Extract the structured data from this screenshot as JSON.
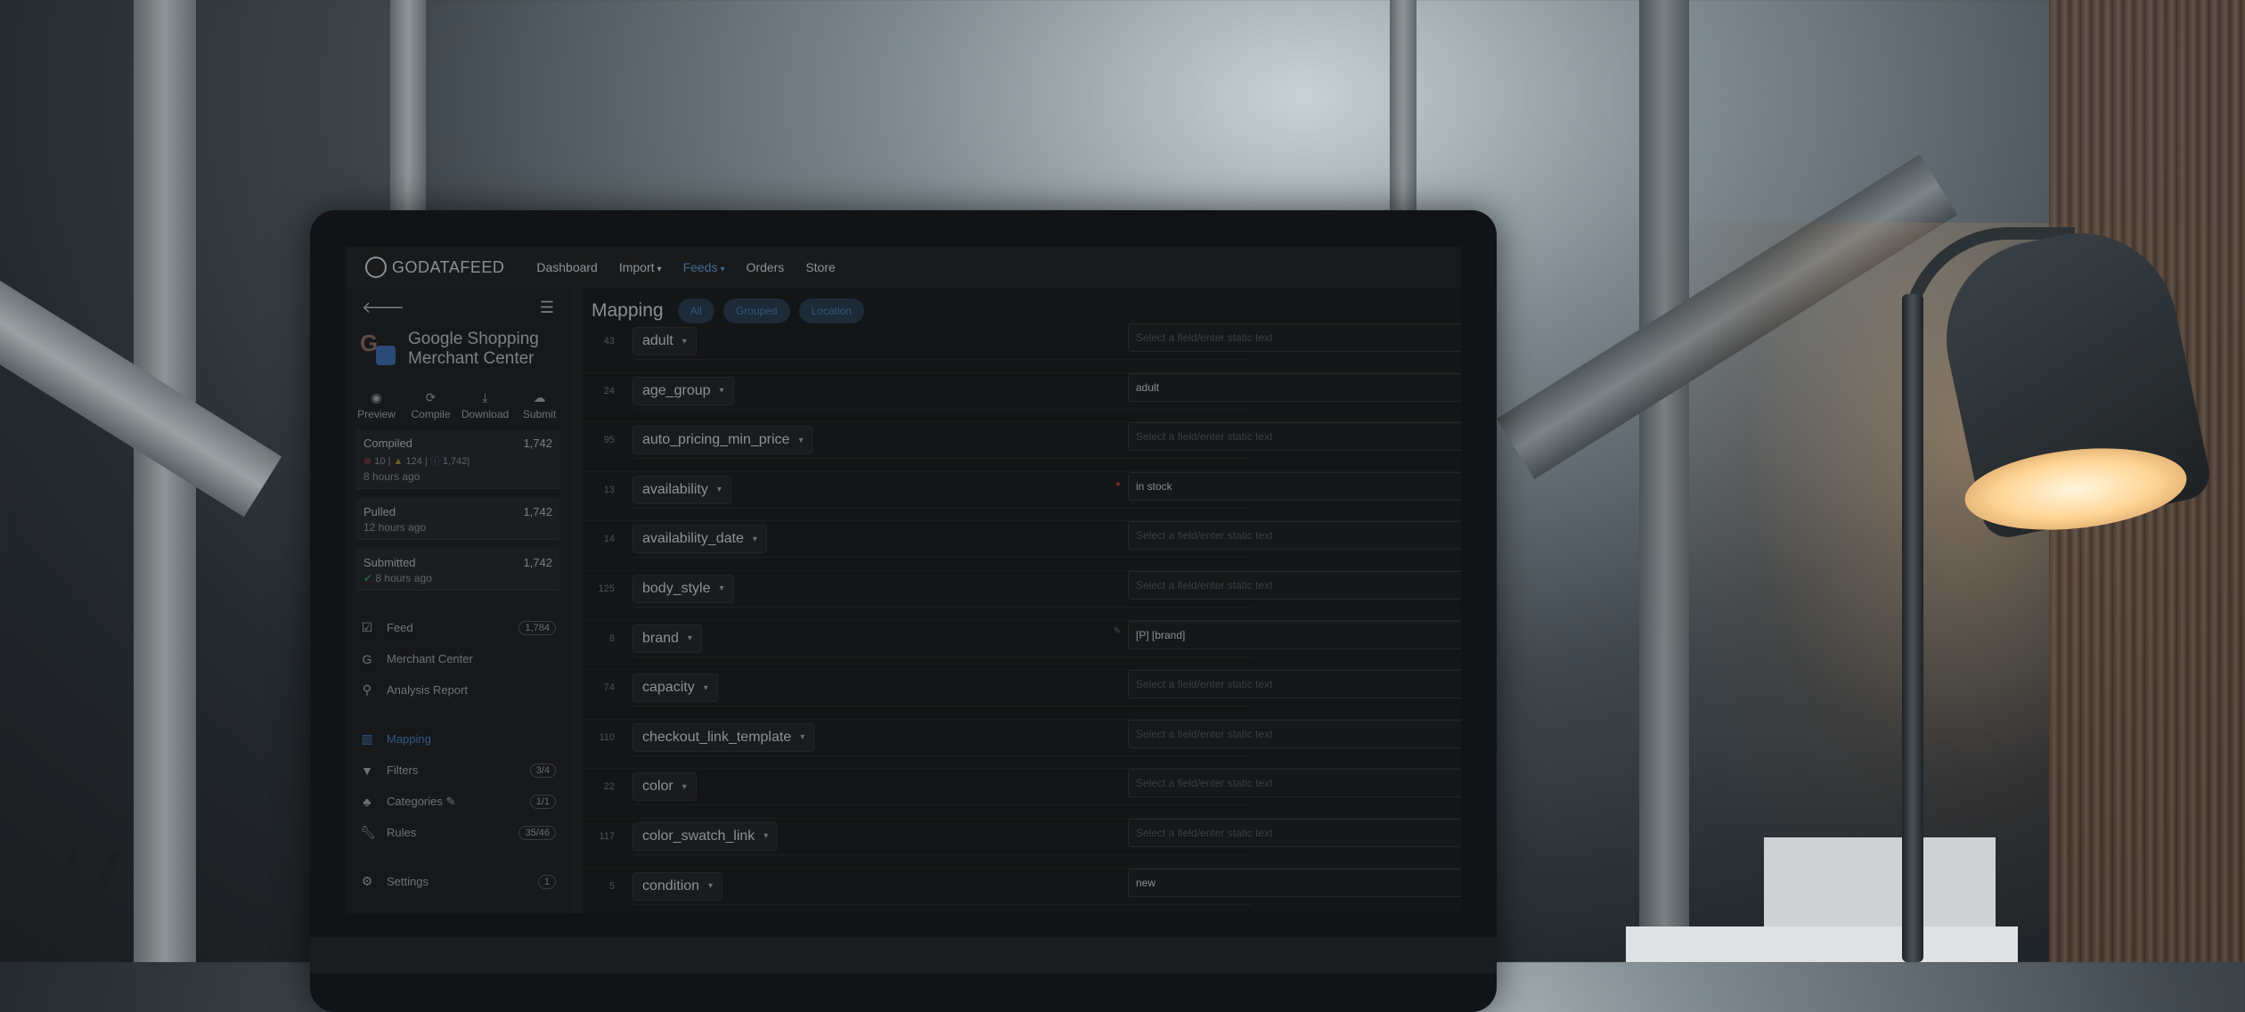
{
  "nav": {
    "logo": "GODATAFEED",
    "items": [
      {
        "label": "Dashboard",
        "caret": false,
        "active": false
      },
      {
        "label": "Import",
        "caret": true,
        "active": false
      },
      {
        "label": "Feeds",
        "caret": true,
        "active": true
      },
      {
        "label": "Orders",
        "caret": false,
        "active": false
      },
      {
        "label": "Store",
        "caret": false,
        "active": false
      }
    ]
  },
  "feed": {
    "title_line1": "Google Shopping",
    "title_line2": "Merchant Center"
  },
  "actions": [
    {
      "label": "Preview",
      "icon": "eye-icon"
    },
    {
      "label": "Compile",
      "icon": "refresh-icon"
    },
    {
      "label": "Download",
      "icon": "download-icon"
    },
    {
      "label": "Submit",
      "icon": "cloud-upload-icon"
    }
  ],
  "status": {
    "compiled": {
      "label": "Compiled",
      "count": "1,742",
      "errors": "10",
      "warnings": "124",
      "info": "1,742",
      "time": "8 hours ago"
    },
    "pulled": {
      "label": "Pulled",
      "count": "1,742",
      "time": "12 hours ago"
    },
    "submitted": {
      "label": "Submitted",
      "count": "1,742",
      "time": "8 hours ago"
    }
  },
  "menu": {
    "group1": [
      {
        "label": "Feed",
        "badge": "1,784",
        "icon": "checkbox-icon"
      },
      {
        "label": "Merchant Center",
        "badge": "",
        "icon": "google-icon"
      },
      {
        "label": "Analysis Report",
        "badge": "",
        "icon": "search-icon"
      }
    ],
    "group2": [
      {
        "label": "Mapping",
        "badge": "",
        "icon": "map-icon",
        "active": true
      },
      {
        "label": "Filters",
        "badge": "3/4",
        "icon": "filter-icon"
      },
      {
        "label": "Categories",
        "badge": "1/1",
        "icon": "tree-icon"
      },
      {
        "label": "Rules",
        "badge": "35/46",
        "icon": "wrench-icon"
      }
    ],
    "group3": [
      {
        "label": "Settings",
        "badge": "1",
        "icon": "gears-icon"
      }
    ]
  },
  "main": {
    "title": "Mapping",
    "filters": [
      "All",
      "Grouped",
      "Location"
    ],
    "placeholder": "Select a field/enter static text",
    "rows": [
      {
        "num": "43",
        "field": "adult",
        "value": "",
        "marker": ""
      },
      {
        "num": "24",
        "field": "age_group",
        "value": "adult",
        "marker": ""
      },
      {
        "num": "95",
        "field": "auto_pricing_min_price",
        "value": "",
        "marker": ""
      },
      {
        "num": "13",
        "field": "availability",
        "value": "in stock",
        "marker": "required"
      },
      {
        "num": "14",
        "field": "availability_date",
        "value": "",
        "marker": ""
      },
      {
        "num": "125",
        "field": "body_style",
        "value": "",
        "marker": ""
      },
      {
        "num": "8",
        "field": "brand",
        "value": "[P] [brand]",
        "marker": "flag"
      },
      {
        "num": "74",
        "field": "capacity",
        "value": "",
        "marker": ""
      },
      {
        "num": "110",
        "field": "checkout_link_template",
        "value": "",
        "marker": ""
      },
      {
        "num": "22",
        "field": "color",
        "value": "",
        "marker": ""
      },
      {
        "num": "117",
        "field": "color_swatch_link",
        "value": "",
        "marker": ""
      },
      {
        "num": "5",
        "field": "condition",
        "value": "new",
        "marker": ""
      }
    ]
  }
}
